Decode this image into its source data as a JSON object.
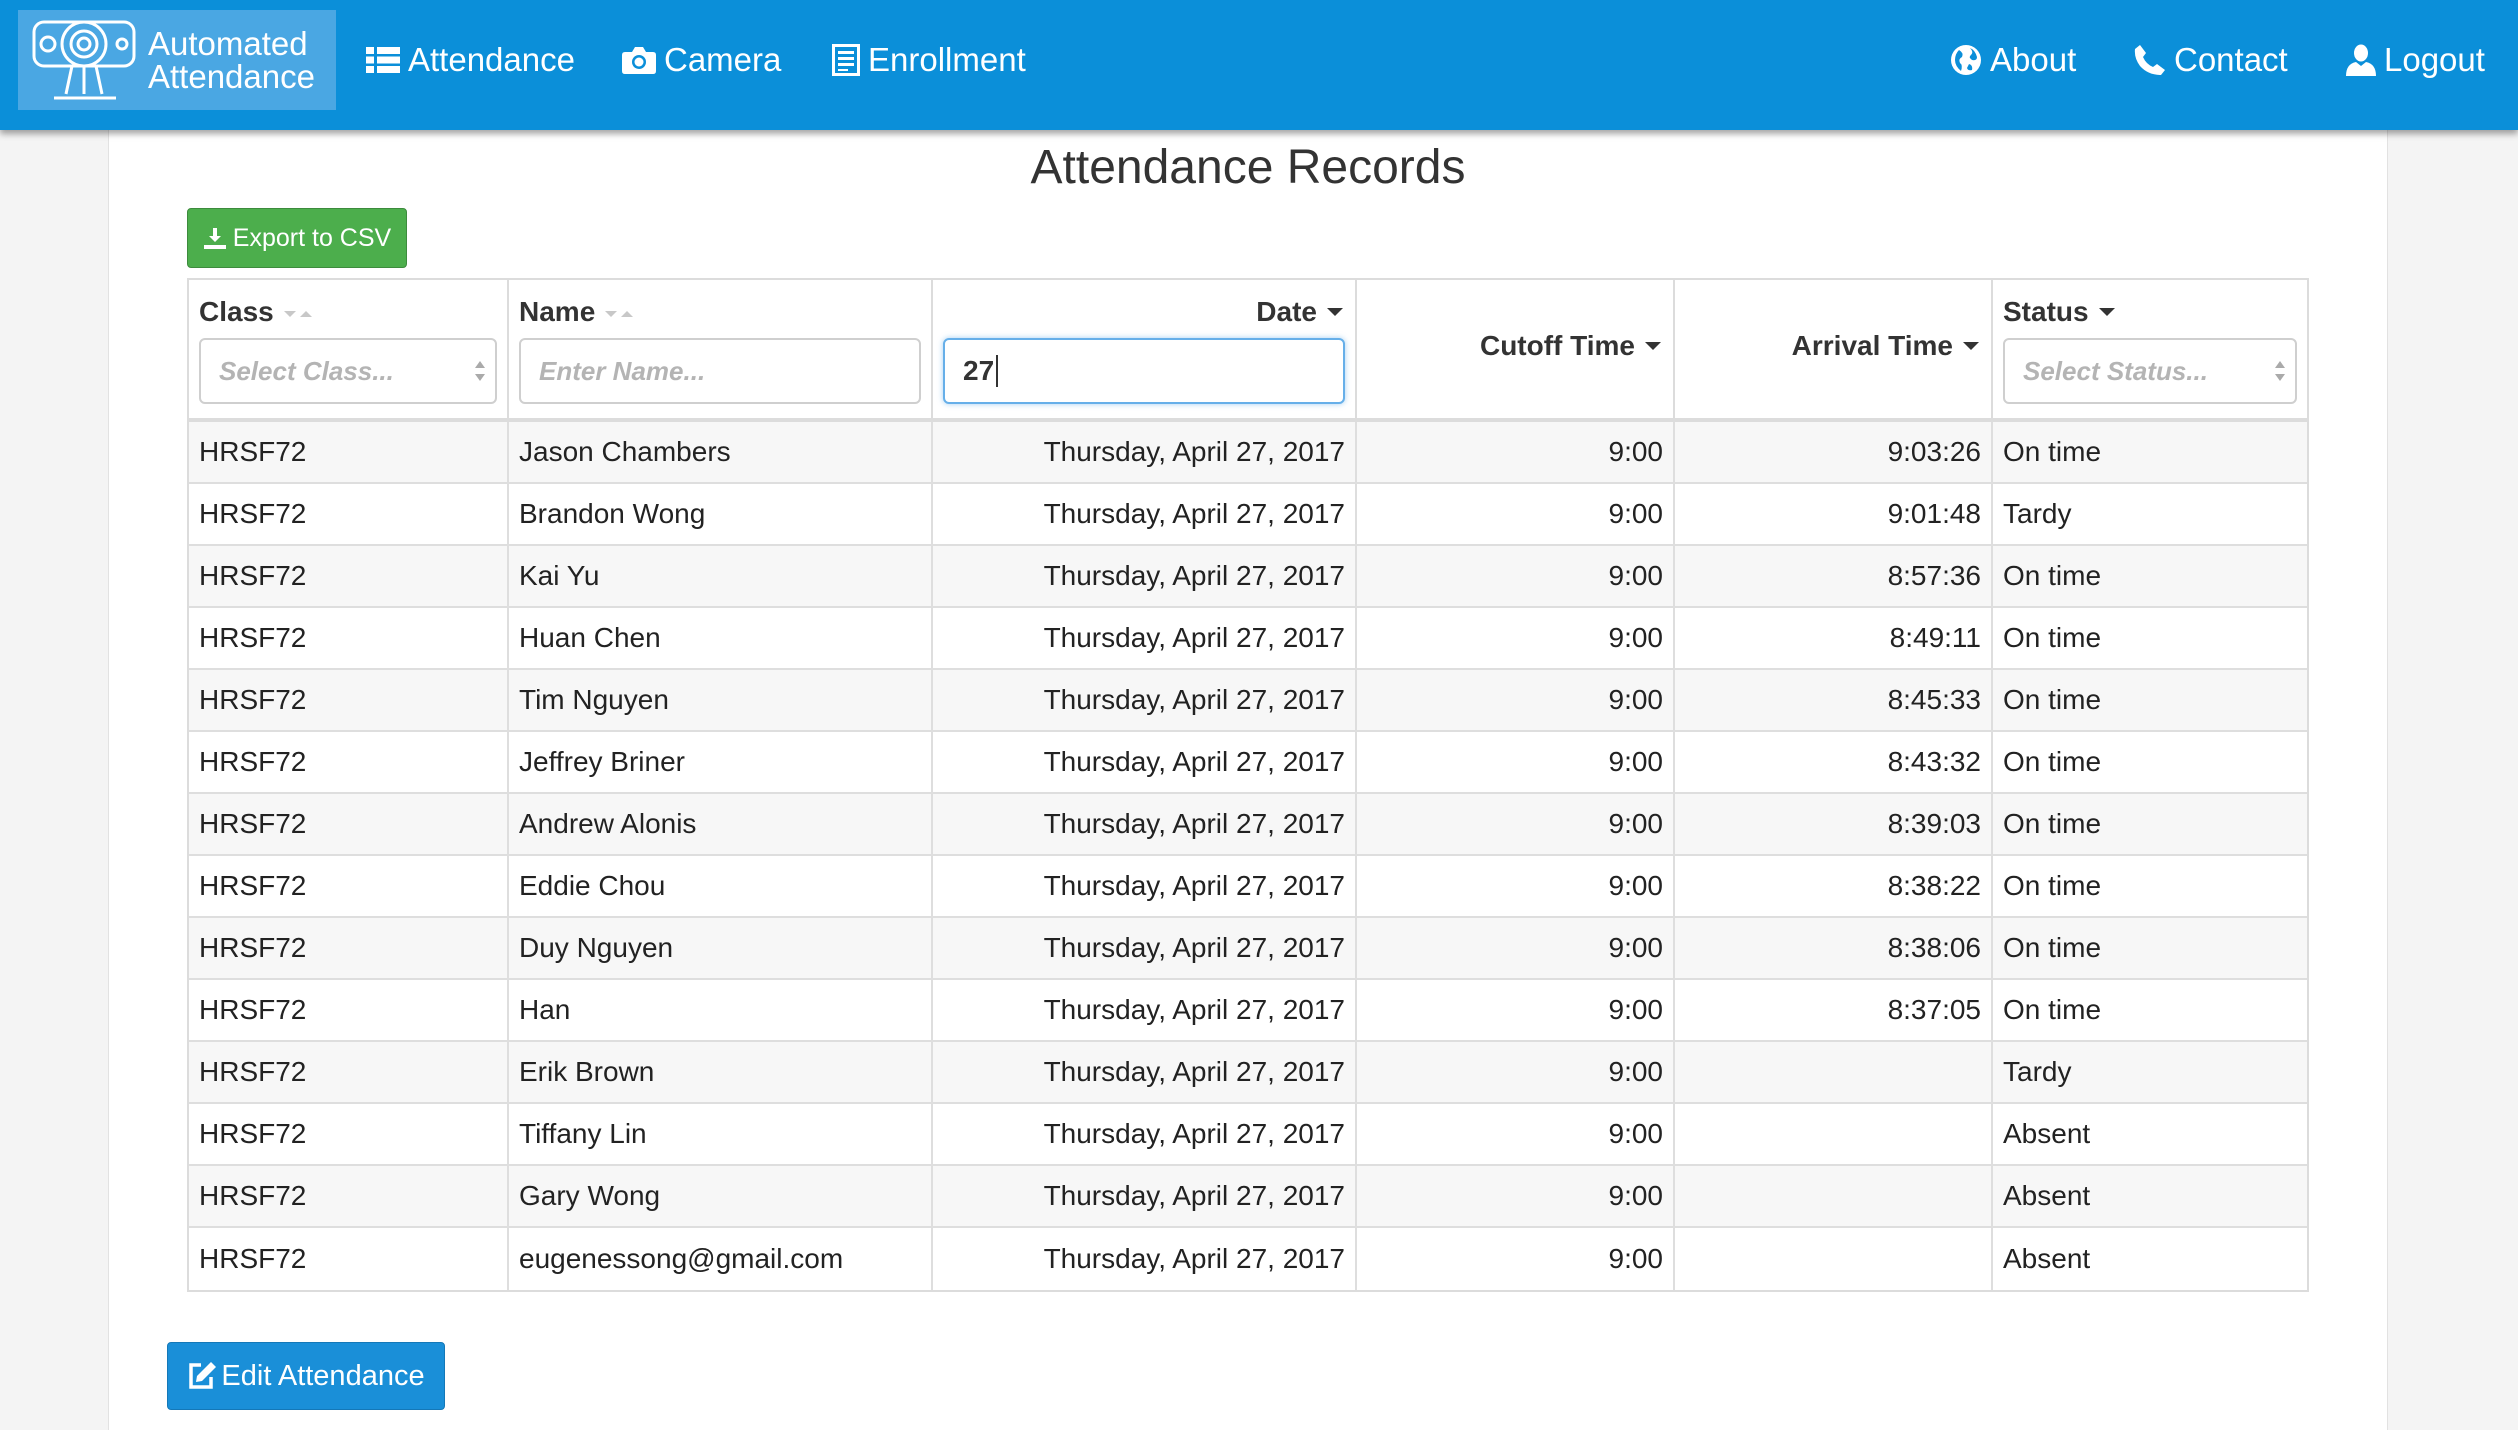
{
  "nav": {
    "brand_line1": "Automated",
    "brand_line2": "Attendance",
    "left_items": [
      {
        "label": "Attendance",
        "icon": "list-icon"
      },
      {
        "label": "Camera",
        "icon": "camera-icon"
      },
      {
        "label": "Enrollment",
        "icon": "clipboard-icon"
      }
    ],
    "right_items": [
      {
        "label": "About",
        "icon": "globe-icon"
      },
      {
        "label": "Contact",
        "icon": "phone-icon"
      },
      {
        "label": "Logout",
        "icon": "user-icon"
      }
    ]
  },
  "page": {
    "title": "Attendance Records",
    "export_label": "Export to CSV",
    "edit_label": "Edit Attendance"
  },
  "table": {
    "headers": {
      "class": "Class",
      "name": "Name",
      "date": "Date",
      "cutoff": "Cutoff Time",
      "arrival": "Arrival Time",
      "status": "Status"
    },
    "filters": {
      "class_placeholder": "Select Class...",
      "name_placeholder": "Enter Name...",
      "date_value": "27",
      "status_placeholder": "Select Status..."
    },
    "rows": [
      [
        "HRSF72",
        "Jason Chambers",
        "Thursday, April 27, 2017",
        "9:00",
        "9:03:26",
        "On time"
      ],
      [
        "HRSF72",
        "Brandon Wong",
        "Thursday, April 27, 2017",
        "9:00",
        "9:01:48",
        "Tardy"
      ],
      [
        "HRSF72",
        "Kai Yu",
        "Thursday, April 27, 2017",
        "9:00",
        "8:57:36",
        "On time"
      ],
      [
        "HRSF72",
        "Huan Chen",
        "Thursday, April 27, 2017",
        "9:00",
        "8:49:11",
        "On time"
      ],
      [
        "HRSF72",
        "Tim Nguyen",
        "Thursday, April 27, 2017",
        "9:00",
        "8:45:33",
        "On time"
      ],
      [
        "HRSF72",
        "Jeffrey Briner",
        "Thursday, April 27, 2017",
        "9:00",
        "8:43:32",
        "On time"
      ],
      [
        "HRSF72",
        "Andrew Alonis",
        "Thursday, April 27, 2017",
        "9:00",
        "8:39:03",
        "On time"
      ],
      [
        "HRSF72",
        "Eddie Chou",
        "Thursday, April 27, 2017",
        "9:00",
        "8:38:22",
        "On time"
      ],
      [
        "HRSF72",
        "Duy Nguyen",
        "Thursday, April 27, 2017",
        "9:00",
        "8:38:06",
        "On time"
      ],
      [
        "HRSF72",
        "Han",
        "Thursday, April 27, 2017",
        "9:00",
        "8:37:05",
        "On time"
      ],
      [
        "HRSF72",
        "Erik Brown",
        "Thursday, April 27, 2017",
        "9:00",
        "",
        "Tardy"
      ],
      [
        "HRSF72",
        "Tiffany Lin",
        "Thursday, April 27, 2017",
        "9:00",
        "",
        "Absent"
      ],
      [
        "HRSF72",
        "Gary Wong",
        "Thursday, April 27, 2017",
        "9:00",
        "",
        "Absent"
      ],
      [
        "HRSF72",
        "eugenessong@gmail.com",
        "Thursday, April 27, 2017",
        "9:00",
        "",
        "Absent"
      ]
    ]
  },
  "colors": {
    "navbar": "#0b8fd9",
    "brand_bg": "#4aa7e3",
    "export_button": "#4cae4c",
    "edit_button": "#1a8fd8"
  }
}
